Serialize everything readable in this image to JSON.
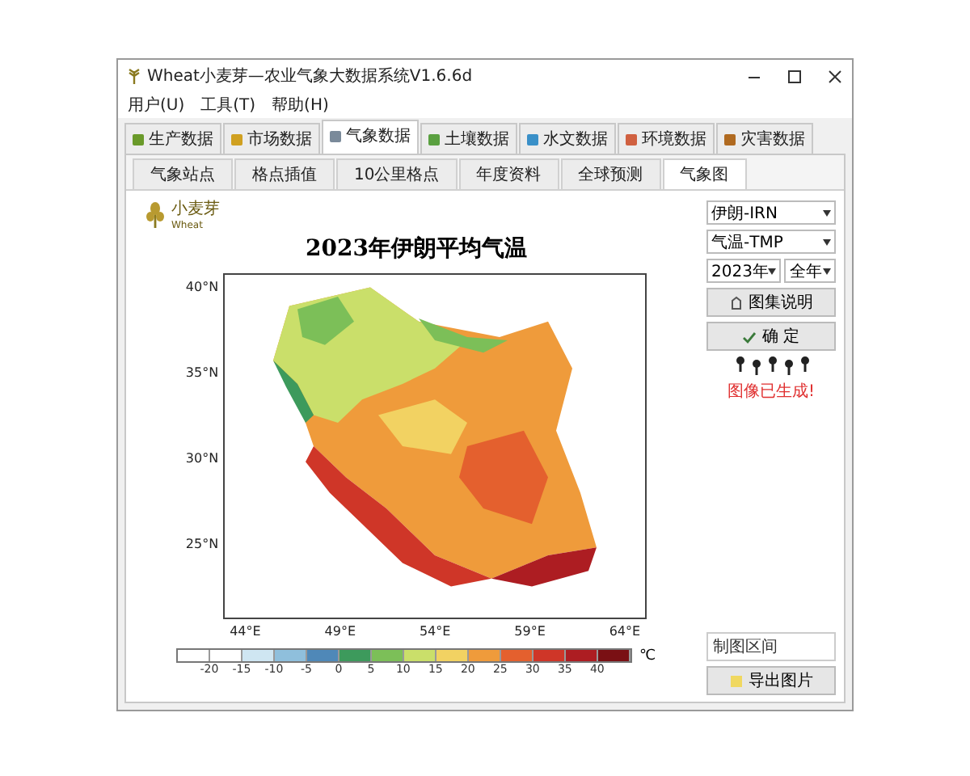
{
  "window": {
    "title": "Wheat小麦芽—农业气象大数据系统V1.6.6d"
  },
  "menu": [
    "用户(U)",
    "工具(T)",
    "帮助(H)"
  ],
  "tabs": [
    {
      "label": "生产数据",
      "selected": false
    },
    {
      "label": "市场数据",
      "selected": false
    },
    {
      "label": "气象数据",
      "selected": true
    },
    {
      "label": "土壤数据",
      "selected": false
    },
    {
      "label": "水文数据",
      "selected": false
    },
    {
      "label": "环境数据",
      "selected": false
    },
    {
      "label": "灾害数据",
      "selected": false
    }
  ],
  "subtabs": [
    {
      "label": "气象站点",
      "selected": false
    },
    {
      "label": "格点插值",
      "selected": false
    },
    {
      "label": "10公里格点",
      "selected": false
    },
    {
      "label": "年度资料",
      "selected": false
    },
    {
      "label": "全球预测",
      "selected": false
    },
    {
      "label": "气象图",
      "selected": true
    }
  ],
  "logo": {
    "name": "小麦芽",
    "subtitle": "Wheat"
  },
  "map": {
    "title": "2023年伊朗平均气温",
    "kind": "picture",
    "lat_labels": [
      "40°N",
      "35°N",
      "30°N",
      "25°N"
    ],
    "lon_labels": [
      "44°E",
      "49°E",
      "54°E",
      "59°E",
      "64°E"
    ]
  },
  "colorbar": {
    "unit": "℃",
    "ticks": [
      "-20",
      "-15",
      "-10",
      "-5",
      "0",
      "5",
      "10",
      "15",
      "20",
      "25",
      "30",
      "35",
      "40"
    ],
    "segments": [
      {
        "color": "#ffffff"
      },
      {
        "color": "#ffffff"
      },
      {
        "color": "#cfe6f2"
      },
      {
        "color": "#8fbfdc"
      },
      {
        "color": "#4f88b8"
      },
      {
        "color": "#3d9a5c"
      },
      {
        "color": "#7cbf58"
      },
      {
        "color": "#cadf6a"
      },
      {
        "color": "#f2d262"
      },
      {
        "color": "#ef9b3b"
      },
      {
        "color": "#e4602e"
      },
      {
        "color": "#cf3628"
      },
      {
        "color": "#ad1d22"
      },
      {
        "color": "#7a1014"
      }
    ]
  },
  "controls": {
    "country": "伊朗-IRN",
    "variable": "气温-TMP",
    "year": "2023年",
    "period": "全年",
    "atlas_button": "图集说明",
    "confirm_button": "确 定",
    "status": "图像已生成!",
    "range_field": "制图区间",
    "export_button": "导出图片"
  }
}
